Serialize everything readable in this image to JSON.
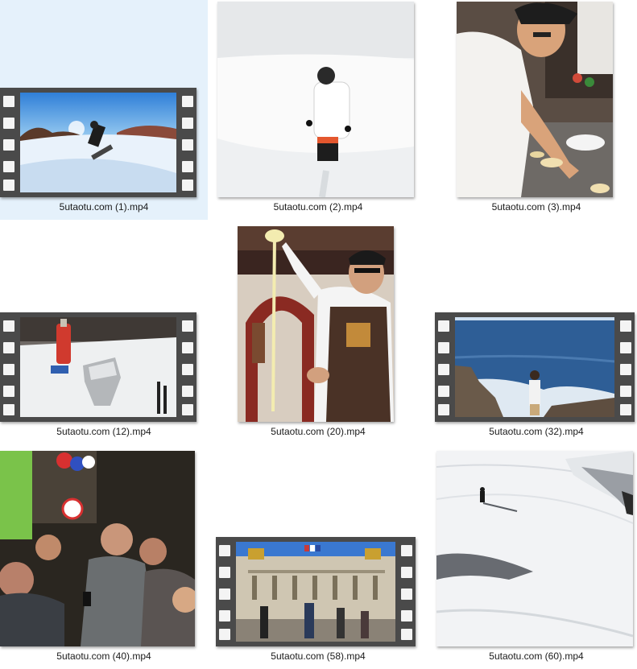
{
  "files": [
    {
      "name": "5utaotu.com (1).mp4",
      "selected": true
    },
    {
      "name": "5utaotu.com (2).mp4"
    },
    {
      "name": "5utaotu.com (3).mp4"
    },
    {
      "name": "5utaotu.com (12).mp4"
    },
    {
      "name": "5utaotu.com (20).mp4"
    },
    {
      "name": "5utaotu.com (32).mp4"
    },
    {
      "name": "5utaotu.com (40).mp4"
    },
    {
      "name": "5utaotu.com (58).mp4"
    },
    {
      "name": "5utaotu.com (60).mp4"
    }
  ],
  "colors": {
    "selection_bg": "#e5f1fb",
    "film_strip": "#4a4a4a"
  }
}
